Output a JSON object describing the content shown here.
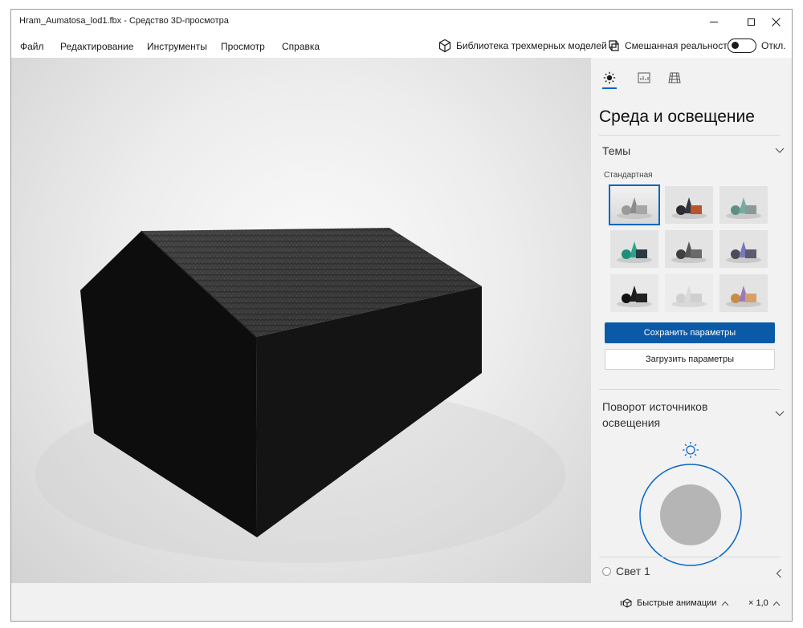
{
  "window": {
    "title": "Hram_Aumatosa_lod1.fbx - Средство 3D-просмотра"
  },
  "menu": {
    "items": [
      "Файл",
      "Редактирование",
      "Инструменты",
      "Просмотр",
      "Справка"
    ],
    "library_label": "Библиотека трехмерных моделей",
    "mixed_reality_label": "Смешанная реальность",
    "toggle_state": "Откл."
  },
  "panel": {
    "title": "Среда и освещение",
    "themes": {
      "heading": "Темы",
      "selected_name": "Стандартная",
      "save_label": "Сохранить параметры",
      "load_label": "Загрузить параметры"
    },
    "rotation": {
      "heading": "Поворот источников освещения"
    },
    "light": {
      "label": "Свет 1"
    }
  },
  "status": {
    "animations_label": "Быстрые анимации",
    "speed": "× 1,0"
  },
  "colors": {
    "accent": "#0a64c8",
    "primary_button": "#0a5aa8"
  }
}
